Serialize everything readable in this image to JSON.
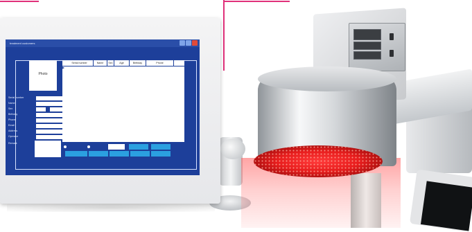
{
  "software": {
    "window_title": "treatment customers",
    "photo_label": "Photo",
    "table_headers": [
      "Serial number",
      "Name",
      "Sex",
      "Age",
      "Birthday",
      "Phone"
    ],
    "row_marker": "▶",
    "field_labels": [
      "Serial number",
      "Name",
      "Sex",
      "Birthday",
      "Phone",
      "Email",
      "Address",
      "Operator",
      "Remark"
    ]
  },
  "colors": {
    "accent_line": "#e0307a",
    "screen_blue": "#1d3f9a",
    "button_cyan": "#2ba0e0",
    "led_red": "#e81e1e"
  }
}
